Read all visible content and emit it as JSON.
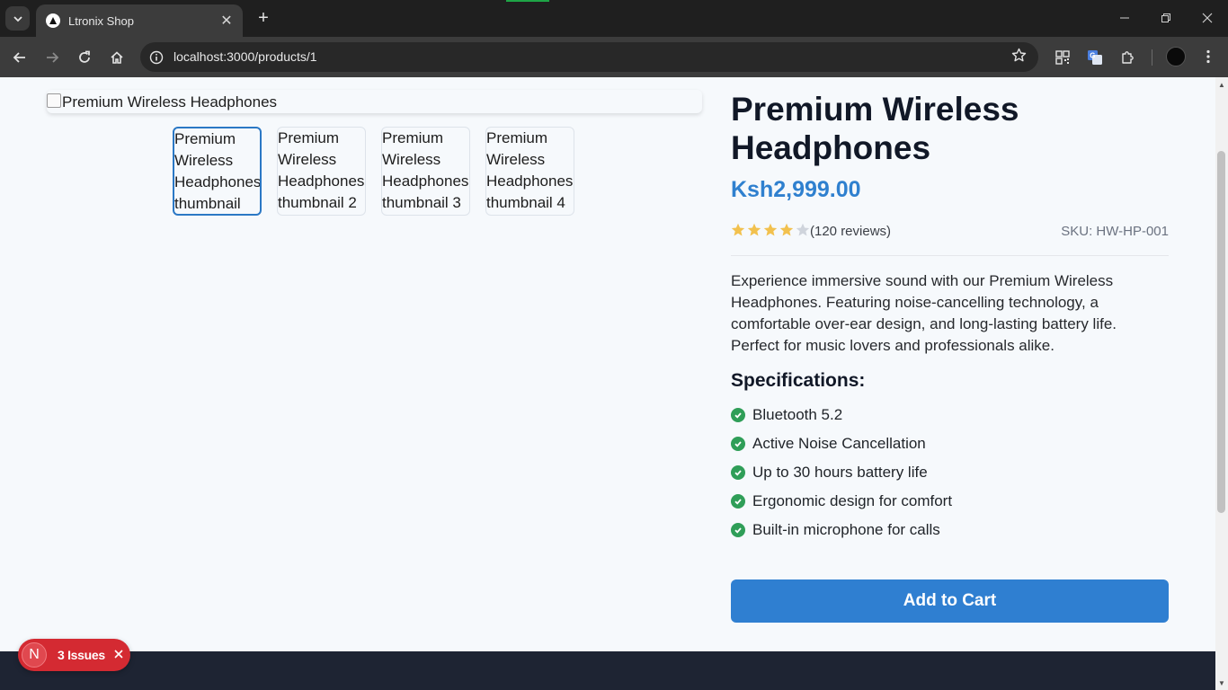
{
  "browser": {
    "tab_title": "Ltronix Shop",
    "url": "localhost:3000/products/1",
    "tab_close_glyph": "✕",
    "new_tab_glyph": "+"
  },
  "product": {
    "main_image_alt": "Premium Wireless Headphones",
    "thumbnails": [
      "Premium Wireless Headphones thumbnail",
      "Premium Wireless Headphones thumbnail 2",
      "Premium Wireless Headphones thumbnail 3",
      "Premium Wireless Headphones thumbnail 4"
    ],
    "title": "Premium Wireless Headphones",
    "price": "Ksh2,999.00",
    "rating": 4,
    "rating_max": 5,
    "reviews": "(120 reviews)",
    "sku": "SKU: HW-HP-001",
    "description": "Experience immersive sound with our Premium Wireless Headphones. Featuring noise-cancelling technology, a comfortable over-ear design, and long-lasting battery life. Perfect for music lovers and professionals alike.",
    "specs_title": "Specifications:",
    "specs": [
      "Bluetooth 5.2",
      "Active Noise Cancellation",
      "Up to 30 hours battery life",
      "Ergonomic design for comfort",
      "Built-in microphone for calls"
    ],
    "add_to_cart": "Add to Cart"
  },
  "dev_overlay": {
    "badge_letter": "N",
    "issues_label": "3 Issues"
  },
  "colors": {
    "accent": "#2f7fd1",
    "price": "#2f80cf",
    "star_filled": "#f2c14e",
    "star_empty": "#cfd4dc",
    "check": "#2f9e58",
    "issues_badge": "#d42a32",
    "footer": "#1e2433"
  },
  "icons": {
    "tab_search": "chevron-down-icon",
    "back": "arrow-left-icon",
    "forward": "arrow-right-icon",
    "reload": "reload-icon",
    "home": "home-icon",
    "site_info": "info-icon",
    "bookmark": "star-icon",
    "extensions": [
      "qr-code-icon",
      "translate-icon",
      "puzzle-icon"
    ],
    "menu": "more-vert-icon"
  }
}
